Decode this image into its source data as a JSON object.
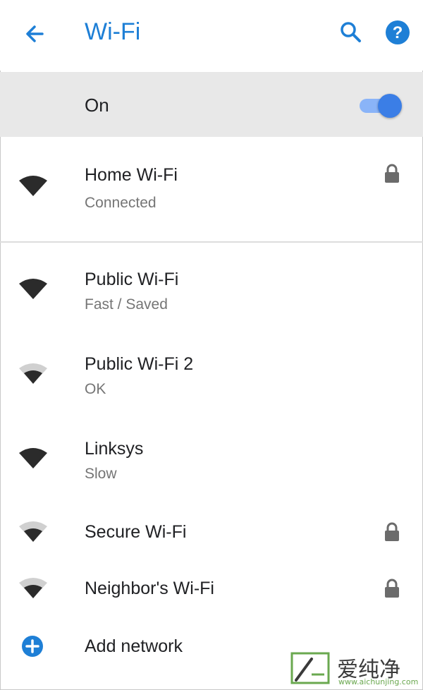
{
  "app_bar": {
    "title": "Wi-Fi"
  },
  "wifi_toggle": {
    "label": "On",
    "enabled": true
  },
  "connected": {
    "name": "Home Wi-Fi",
    "status": "Connected",
    "secured": true,
    "signal": "strong"
  },
  "networks": [
    {
      "name": "Public Wi-Fi",
      "status": "Fast / Saved",
      "secured": false,
      "signal": "strong"
    },
    {
      "name": "Public Wi-Fi 2",
      "status": "OK",
      "secured": false,
      "signal": "medium"
    },
    {
      "name": "Linksys",
      "status": "Slow",
      "secured": false,
      "signal": "strong"
    },
    {
      "name": "Secure Wi-Fi",
      "status": "",
      "secured": true,
      "signal": "medium"
    },
    {
      "name": "Neighbor's Wi-Fi",
      "status": "",
      "secured": true,
      "signal": "medium"
    }
  ],
  "add_network": {
    "label": "Add network"
  },
  "watermark": {
    "name": "爱纯净",
    "url": "www.aichunjing.com"
  },
  "colors": {
    "accent": "#1e7fd6",
    "switch_thumb": "#3b7ee6",
    "switch_track": "#8ab4f8",
    "on_row_bg": "#e8e8e8",
    "icon_dark": "#2b2b2b",
    "icon_light": "#d0d0d0"
  },
  "icons": {
    "back": "arrow-left-icon",
    "search": "search-icon",
    "help": "help-icon",
    "wifi": "wifi-signal-icon",
    "lock": "lock-icon",
    "add": "add-circle-icon"
  }
}
